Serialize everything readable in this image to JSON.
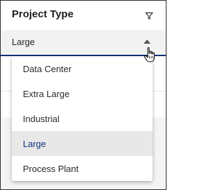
{
  "header": {
    "title": "Project Type",
    "filter_icon": "filter-icon"
  },
  "select": {
    "value": "Large",
    "caret_icon": "caret-up-icon"
  },
  "dropdown": {
    "options": [
      {
        "label": "Data Center",
        "selected": false
      },
      {
        "label": "Extra Large",
        "selected": false
      },
      {
        "label": "Industrial",
        "selected": false
      },
      {
        "label": "Large",
        "selected": true
      },
      {
        "label": "Process Plant",
        "selected": false
      }
    ]
  },
  "colors": {
    "accent": "#0b2f7c",
    "selected_bg": "#e8e8e8",
    "field_bg": "#f2f2f2"
  }
}
